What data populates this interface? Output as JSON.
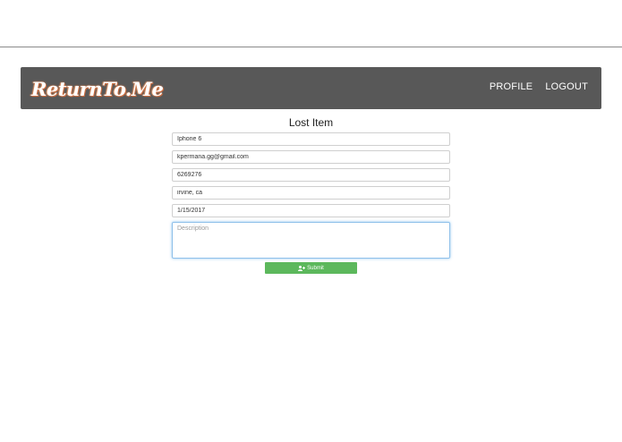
{
  "header": {
    "brand": "ReturnTo.Me",
    "nav": [
      {
        "label": "PROFILE"
      },
      {
        "label": "LOGOUT"
      }
    ]
  },
  "form": {
    "title": "Lost Item",
    "fields": [
      {
        "value": "Iphone 6"
      },
      {
        "value": "kpermana.gg@gmail.com"
      },
      {
        "value": "6269276"
      },
      {
        "value": "irvine, ca"
      },
      {
        "value": "1/15/2017"
      }
    ],
    "description": {
      "value": "",
      "placeholder": "Description"
    },
    "submit": {
      "label": "Submit",
      "icon": "user-plus-icon"
    }
  },
  "colors": {
    "navbar": "#585858",
    "submit": "#5cb85c",
    "focus_border": "#8fc0ea"
  }
}
